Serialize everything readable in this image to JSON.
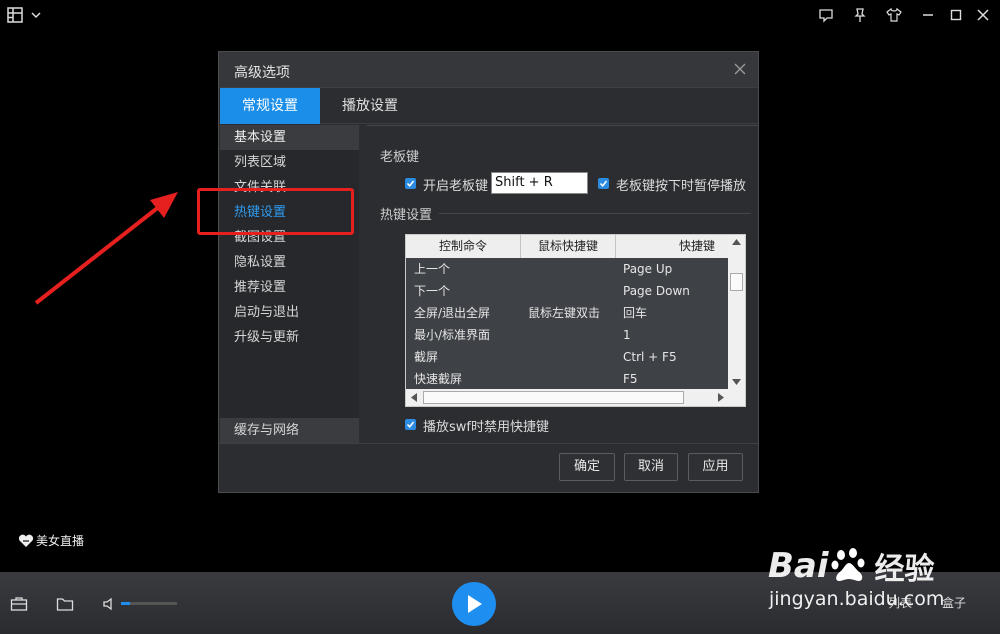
{
  "app": {
    "live_label": "美女直播",
    "bottom_partial_1": "列表",
    "bottom_partial_2": "盒子"
  },
  "dialog": {
    "title": "高级选项",
    "tabs": [
      {
        "label": "常规设置",
        "active": true
      },
      {
        "label": "播放设置",
        "active": false
      }
    ],
    "sidebar": [
      {
        "label": "基本设置",
        "selected": true
      },
      {
        "label": "列表区域",
        "selected": false
      },
      {
        "label": "文件关联",
        "selected": false
      },
      {
        "label": "热键设置",
        "selected": false
      },
      {
        "label": "截图设置",
        "selected": false
      },
      {
        "label": "隐私设置",
        "selected": false
      },
      {
        "label": "推荐设置",
        "selected": false
      },
      {
        "label": "启动与退出",
        "selected": false
      },
      {
        "label": "升级与更新",
        "selected": false
      }
    ],
    "sidebar_bottom": "缓存与网络",
    "boss_key": {
      "section": "老板键",
      "enable_label": "开启老板键",
      "enable_checked": true,
      "key_value": "Shift + R",
      "pause_label": "老板键按下时暂停播放",
      "pause_checked": true
    },
    "hotkeys": {
      "section": "热键设置",
      "columns": [
        "控制命令",
        "鼠标快捷键",
        "快捷键"
      ],
      "rows": [
        [
          "上一个",
          "",
          "Page Up"
        ],
        [
          "下一个",
          "",
          "Page Down"
        ],
        [
          "全屏/退出全屏",
          "鼠标左键双击",
          "回车"
        ],
        [
          "最小/标准界面",
          "",
          "1"
        ],
        [
          "截屏",
          "",
          "Ctrl + F5"
        ],
        [
          "快速截屏",
          "",
          "F5"
        ]
      ],
      "swf_label": "播放swf时禁用快捷键",
      "swf_checked": true
    },
    "buttons": {
      "ok": "确定",
      "cancel": "取消",
      "apply": "应用"
    }
  },
  "watermark": {
    "brand_left": "Bai",
    "brand_right": "经验",
    "url": "jingyan.baidu.com"
  },
  "colors": {
    "accent": "#1a8ee8",
    "annotation": "#e5201f"
  }
}
